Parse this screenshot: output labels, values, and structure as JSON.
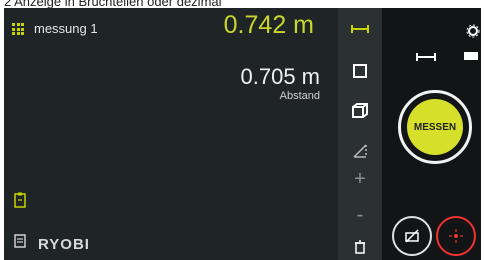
{
  "caption": "2   Anzeige in Bruchteilen oder dezimal",
  "header": {
    "name": "messung 1",
    "main_value": "0.742 m"
  },
  "secondary": {
    "value": "0.705 m",
    "label": "Abstand"
  },
  "brand": "RYOBI",
  "toolbar": {
    "plus": "+",
    "minus": "-"
  },
  "panel": {
    "measure_label": "MESSEN"
  },
  "colors": {
    "accent": "#c8d400",
    "background": "#1f2527",
    "laser": "#e33333"
  },
  "icons": [
    "grid-icon",
    "line-distance-icon",
    "area-icon",
    "volume-icon",
    "angle-icon",
    "trash-icon",
    "settings-icon",
    "clipboard-icon",
    "storage-icon",
    "camera-off-icon",
    "laser-icon"
  ]
}
